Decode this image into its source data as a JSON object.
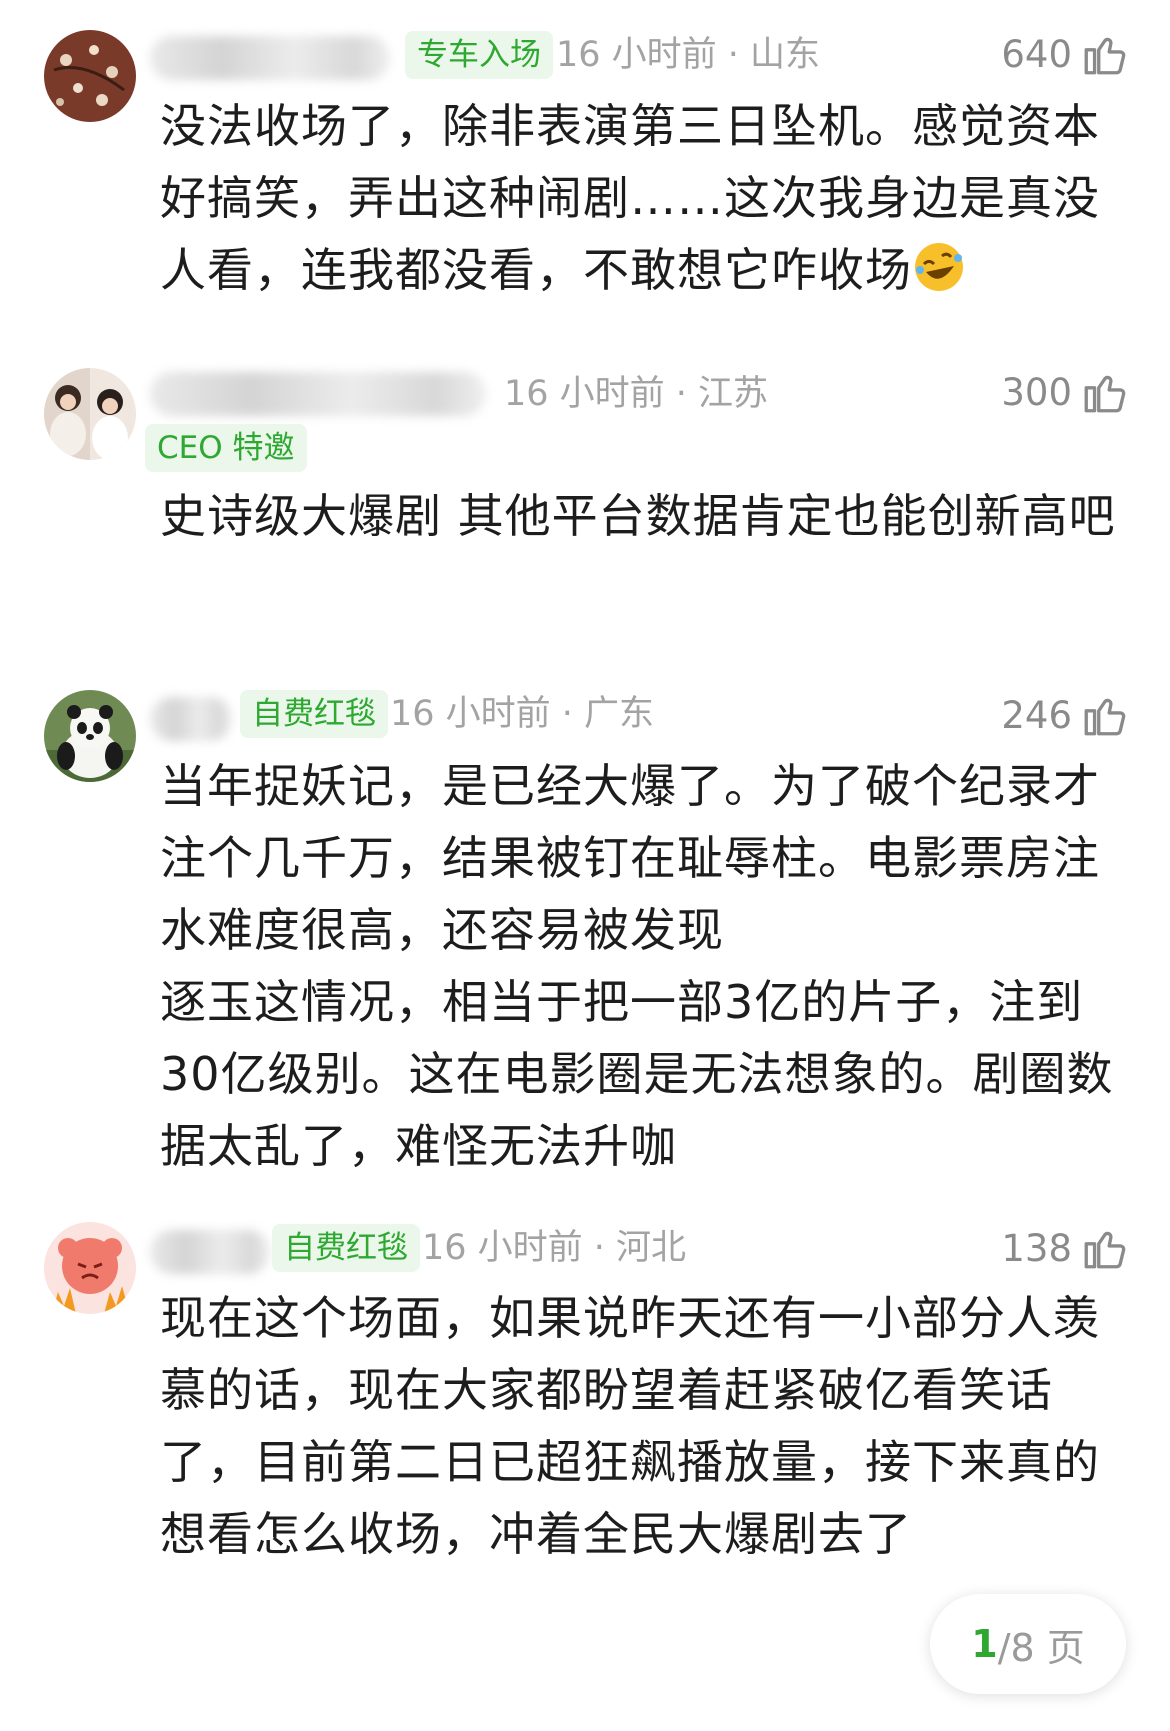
{
  "comments": [
    {
      "badge": "专车入场",
      "meta": "16 小时前 · 山东",
      "likes": "640",
      "text": [
        "没法收场了，除非表演第三日坠机。感觉资本好搞笑，弄出这种闹剧……这次我身边是真没人看，连我都没看，不敢想它咋收场"
      ],
      "emoji": "rolling-on-floor-laughing-emoji"
    },
    {
      "badge": "CEO 特邀",
      "meta": "16 小时前 · 江苏",
      "likes": "300",
      "text": [
        "史诗级大爆剧  其他平台数据肯定也能创新高吧"
      ]
    },
    {
      "badge": "自费红毯",
      "meta": "16 小时前 · 广东",
      "likes": "246",
      "text": [
        "当年捉妖记，是已经大爆了。为了破个纪录才注个几千万，结果被钉在耻辱柱。电影票房注水难度很高，还容易被发现",
        "逐玉这情况，相当于把一部3亿的片子，注到30亿级别。这在电影圈是无法想象的。剧圈数据太乱了，难怪无法升咖"
      ]
    },
    {
      "badge": "自费红毯",
      "meta": "16 小时前 · 河北",
      "likes": "138",
      "text": [
        "现在这个场面，如果说昨天还有一小部分人羡慕的话，现在大家都盼望着赶紧破亿看笑话了，目前第二日已超狂飙播放量，接下来真的想看怎么收场，冲着全民大爆剧去了"
      ]
    }
  ],
  "pager": {
    "current": "1",
    "total": "/8 页"
  },
  "colors": {
    "badge_text": "#2fa832",
    "badge_bg": "#eaf7ea",
    "meta": "#a3a3a3",
    "body": "#1d1d1d"
  },
  "icons": {
    "like": "thumbs-up-icon"
  }
}
